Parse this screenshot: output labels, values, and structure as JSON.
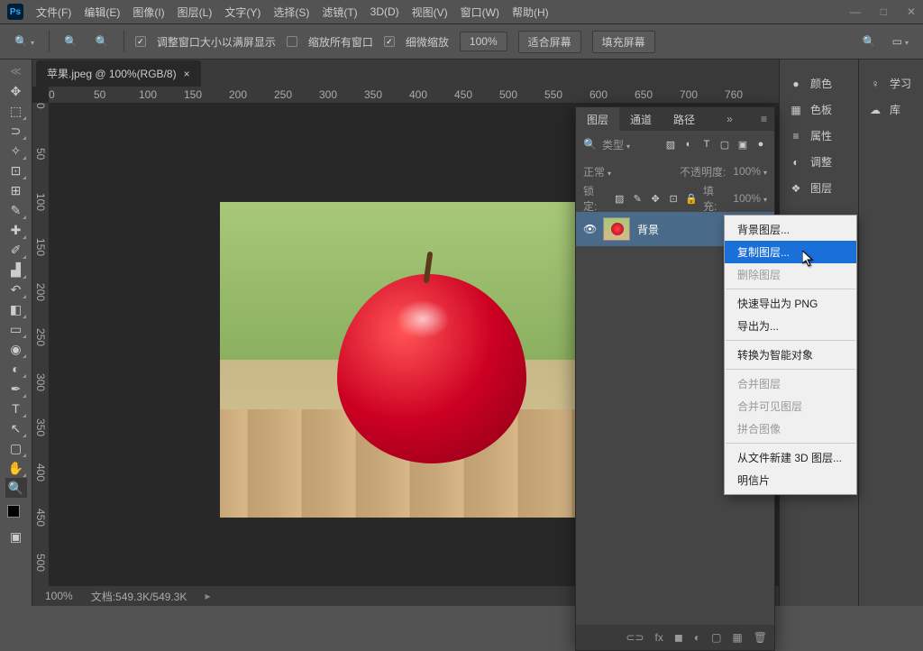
{
  "app": {
    "logo": "Ps"
  },
  "menu": [
    "文件(F)",
    "编辑(E)",
    "图像(I)",
    "图层(L)",
    "文字(Y)",
    "选择(S)",
    "滤镜(T)",
    "3D(D)",
    "视图(V)",
    "窗口(W)",
    "帮助(H)"
  ],
  "options": {
    "opt1": "调整窗口大小以满屏显示",
    "opt1_on": true,
    "opt2": "缩放所有窗口",
    "opt2_on": false,
    "opt3": "细微缩放",
    "opt3_on": true,
    "zoom": "100%",
    "fit": "适合屏幕",
    "fill": "填充屏幕"
  },
  "tab": {
    "label": "苹果.jpeg @ 100%(RGB/8)",
    "close": "×"
  },
  "rulerH": [
    "0",
    "50",
    "100",
    "150",
    "200",
    "250",
    "300",
    "350",
    "400",
    "450",
    "500",
    "550",
    "600",
    "650",
    "700",
    "760"
  ],
  "rulerV": [
    "0",
    "50",
    "100",
    "150",
    "200",
    "250",
    "300",
    "350",
    "400",
    "450",
    "500"
  ],
  "status": {
    "zoom": "100%",
    "doc": "文档:549.3K/549.3K"
  },
  "rightCollapsed": [
    {
      "icon": "●",
      "label": "颜色"
    },
    {
      "icon": "▦",
      "label": "色板"
    },
    {
      "icon": "≡",
      "label": "属性"
    },
    {
      "icon": "◐",
      "label": "调整"
    },
    {
      "icon": "❖",
      "label": "图层"
    }
  ],
  "farCollapsed": [
    {
      "icon": "♀",
      "label": "学习"
    },
    {
      "icon": "☁",
      "label": "库"
    }
  ],
  "layersPanel": {
    "tabs": [
      "图层",
      "通道",
      "路径"
    ],
    "filterLabel": "类型",
    "blend": "正常",
    "opacityLabel": "不透明度:",
    "opacity": "100%",
    "lockLabel": "锁定:",
    "fillLabel": "填充:",
    "fill": "100%",
    "layer": {
      "name": "背景",
      "locked": true
    }
  },
  "context": [
    {
      "t": "背景图层...",
      "s": false
    },
    {
      "t": "复制图层...",
      "s": true
    },
    {
      "t": "删除图层",
      "d": true
    },
    {
      "sep": true
    },
    {
      "t": "快速导出为 PNG"
    },
    {
      "t": "导出为..."
    },
    {
      "sep": true
    },
    {
      "t": "转换为智能对象"
    },
    {
      "sep": true
    },
    {
      "t": "合并图层",
      "d": true
    },
    {
      "t": "合并可见图层",
      "d": true
    },
    {
      "t": "拼合图像",
      "d": true
    },
    {
      "sep": true
    },
    {
      "t": "从文件新建 3D 图层..."
    },
    {
      "t": "明信片"
    }
  ],
  "tools": [
    {
      "n": "move",
      "g": "✥"
    },
    {
      "n": "marquee",
      "g": "⬚",
      "f": true
    },
    {
      "n": "lasso",
      "g": "⊃",
      "f": true
    },
    {
      "n": "magic-wand",
      "g": "✧",
      "f": true
    },
    {
      "n": "crop",
      "g": "⊡",
      "f": true
    },
    {
      "n": "frame",
      "g": "⊞"
    },
    {
      "n": "eyedropper",
      "g": "✎",
      "f": true
    },
    {
      "n": "healing",
      "g": "✚",
      "f": true
    },
    {
      "n": "brush",
      "g": "✐",
      "f": true
    },
    {
      "n": "clone",
      "g": "▟",
      "f": true
    },
    {
      "n": "history",
      "g": "↶",
      "f": true
    },
    {
      "n": "eraser",
      "g": "◧",
      "f": true
    },
    {
      "n": "gradient",
      "g": "▭",
      "f": true
    },
    {
      "n": "blur",
      "g": "◉",
      "f": true
    },
    {
      "n": "dodge",
      "g": "◐",
      "f": true
    },
    {
      "n": "pen",
      "g": "✒",
      "f": true
    },
    {
      "n": "type",
      "g": "T",
      "f": true
    },
    {
      "n": "path",
      "g": "↖",
      "f": true
    },
    {
      "n": "shape",
      "g": "▢",
      "f": true
    },
    {
      "n": "hand",
      "g": "✋",
      "f": true
    },
    {
      "n": "zoom",
      "g": "🔍",
      "a": true
    }
  ]
}
